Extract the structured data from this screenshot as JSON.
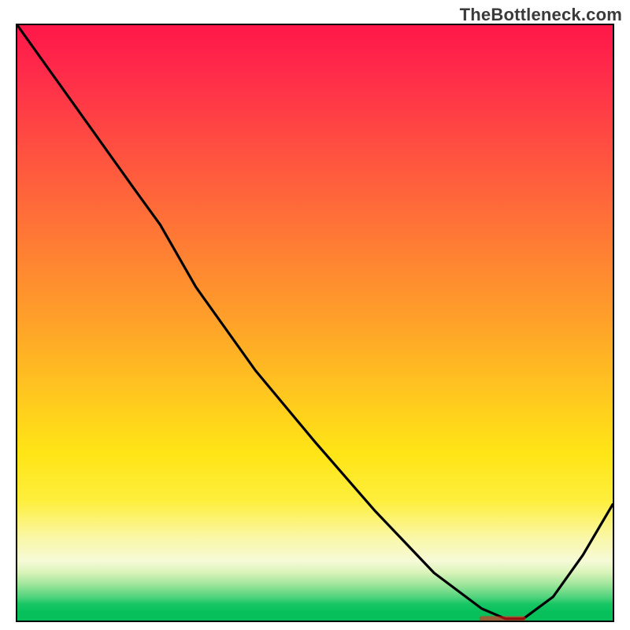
{
  "watermark_text": "TheBottleneck.com",
  "chart_data": {
    "type": "line",
    "title": "",
    "xlabel": "",
    "ylabel": "",
    "xlim": [
      0,
      100
    ],
    "ylim": [
      0,
      100
    ],
    "grid": false,
    "legend": false,
    "background_gradient": {
      "orientation": "vertical",
      "stops": [
        {
          "pos": 0.0,
          "color": "#ff1749"
        },
        {
          "pos": 0.5,
          "color": "#ffa229"
        },
        {
          "pos": 0.78,
          "color": "#fde93a"
        },
        {
          "pos": 0.9,
          "color": "#f5fad0"
        },
        {
          "pos": 0.97,
          "color": "#18c764"
        },
        {
          "pos": 1.0,
          "color": "#07c05c"
        }
      ]
    },
    "series": [
      {
        "name": "curve",
        "x": [
          0,
          5,
          10,
          15,
          20,
          24,
          30,
          40,
          50,
          60,
          70,
          78,
          82,
          85,
          90,
          95,
          100
        ],
        "y": [
          100,
          93,
          86,
          79,
          72,
          66.5,
          56,
          42,
          30,
          18.5,
          8,
          2,
          0.3,
          0.3,
          4,
          11,
          19.5
        ]
      }
    ],
    "marker": {
      "name": "optimum-region",
      "x_start": 78,
      "x_end": 85,
      "y": 0.35,
      "color": "#ff1a1a"
    }
  }
}
